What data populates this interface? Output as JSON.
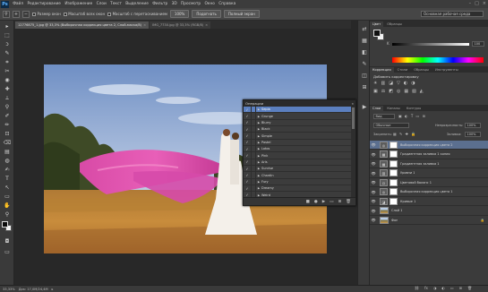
{
  "app": {
    "logo": "Ps"
  },
  "menu": [
    "Файл",
    "Редактирование",
    "Изображение",
    "Слои",
    "Текст",
    "Выделение",
    "Фильтр",
    "3D",
    "Просмотр",
    "Окно",
    "Справка"
  ],
  "window_controls": [
    "–",
    "□",
    "×"
  ],
  "options": {
    "sample_all": "Масштаб всех окон",
    "scrubby_zoom": "Масштаб с перетаскиванием",
    "zoom_100": "100%",
    "fit_screen": "Подогнать",
    "fill_screen": "Полный экран",
    "resize_windows": "Размер окон",
    "workspace": "Основная рабочая среда"
  },
  "tabs": [
    {
      "label": "12776875_1.jpg @ 33,3% (Выборочная коррекция цвета 2, Слой-маска/8)",
      "close": "×",
      "active": true
    },
    {
      "label": "IMG_7730.jpg @ 33,3% (RGB/8)",
      "close": "×",
      "active": false
    }
  ],
  "tools": [
    "▸",
    "⬚",
    "ↄ",
    "✎",
    "⌗",
    "✂",
    "◉",
    "✚",
    "⟂",
    "⚲",
    "✐",
    "✏",
    "⊡",
    "⌫",
    "▤",
    "◍",
    "✍",
    "T",
    "↖",
    "▭",
    "✋",
    "⚲"
  ],
  "status": {
    "zoom": "33,33%",
    "doc": "Док: 17,0M/24,4M"
  },
  "actions_panel": {
    "title": "Операции",
    "close": "«",
    "items": [
      {
        "name": "Sepia",
        "checked": true,
        "selected": true
      },
      {
        "name": "Grunge",
        "checked": true,
        "selected": false
      },
      {
        "name": "Blurry",
        "checked": true,
        "selected": false
      },
      {
        "name": "Black",
        "checked": true,
        "selected": false
      },
      {
        "name": "Simple",
        "checked": true,
        "selected": false
      },
      {
        "name": "Pastel",
        "checked": true,
        "selected": false
      },
      {
        "name": "Lotos",
        "checked": true,
        "selected": false
      },
      {
        "name": "Pink",
        "checked": true,
        "selected": false
      },
      {
        "name": "Aris",
        "checked": true,
        "selected": false
      },
      {
        "name": "Sunrise",
        "checked": true,
        "selected": false
      },
      {
        "name": "Chardin",
        "checked": true,
        "selected": false
      },
      {
        "name": "Fury",
        "checked": true,
        "selected": false
      },
      {
        "name": "Dreamy",
        "checked": true,
        "selected": false
      },
      {
        "name": "Weird",
        "checked": true,
        "selected": false
      }
    ],
    "footer_icons": [
      "■",
      "●",
      "▶",
      "▭",
      "⊞",
      "🗑"
    ]
  },
  "dock_icons": [
    "⇄",
    "▦",
    "◧",
    "✎",
    "◫",
    "⊞",
    "▶"
  ],
  "color_panel": {
    "tabs": [
      "Цвет",
      "Образцы"
    ],
    "slider_label": "K",
    "slider_value": "100"
  },
  "adjust_panel": {
    "tabs": [
      "Коррекция",
      "Стили",
      "Образцы",
      "Инструменты"
    ],
    "title": "Добавить корректировку",
    "icons_row1": [
      "☀",
      "▥",
      "◪",
      "▽",
      "◐",
      "◑"
    ],
    "icons_row2": [
      "▣",
      "⚖",
      "◩",
      "◎",
      "▦",
      "▧",
      "◭"
    ]
  },
  "layers_panel": {
    "tabs": [
      "Слои",
      "Каналы",
      "Контуры"
    ],
    "kind": "Вид",
    "blend_mode": "Обычные",
    "opacity_label": "Непрозрачность:",
    "opacity_value": "100%",
    "lock_label": "Закрепить:",
    "fill_label": "Заливка:",
    "fill_value": "100%",
    "layers": [
      {
        "name": "Выборочная коррекция цвета 2",
        "type": "adj",
        "icon": "◎",
        "selected": true
      },
      {
        "name": "Градиентная заливка 1 копия",
        "type": "adj",
        "icon": "▦",
        "selected": false
      },
      {
        "name": "Градиентная заливка 1",
        "type": "adj",
        "icon": "▦",
        "selected": false
      },
      {
        "name": "Уровни 1",
        "type": "adj",
        "icon": "▥",
        "selected": false
      },
      {
        "name": "Цветовой баланс 1",
        "type": "adj",
        "icon": "⚖",
        "selected": false
      },
      {
        "name": "Выборочная коррекция цвета 1",
        "type": "adj",
        "icon": "◎",
        "selected": false
      },
      {
        "name": "Кривые 1",
        "type": "adj",
        "icon": "◪",
        "selected": false
      },
      {
        "name": "Слой 1",
        "type": "img",
        "icon": "",
        "selected": false
      },
      {
        "name": "Фон",
        "type": "img",
        "icon": "",
        "selected": false
      }
    ],
    "footer_icons": [
      "⛓",
      "fx",
      "◑",
      "◐",
      "▭",
      "⊞",
      "🗑"
    ]
  }
}
